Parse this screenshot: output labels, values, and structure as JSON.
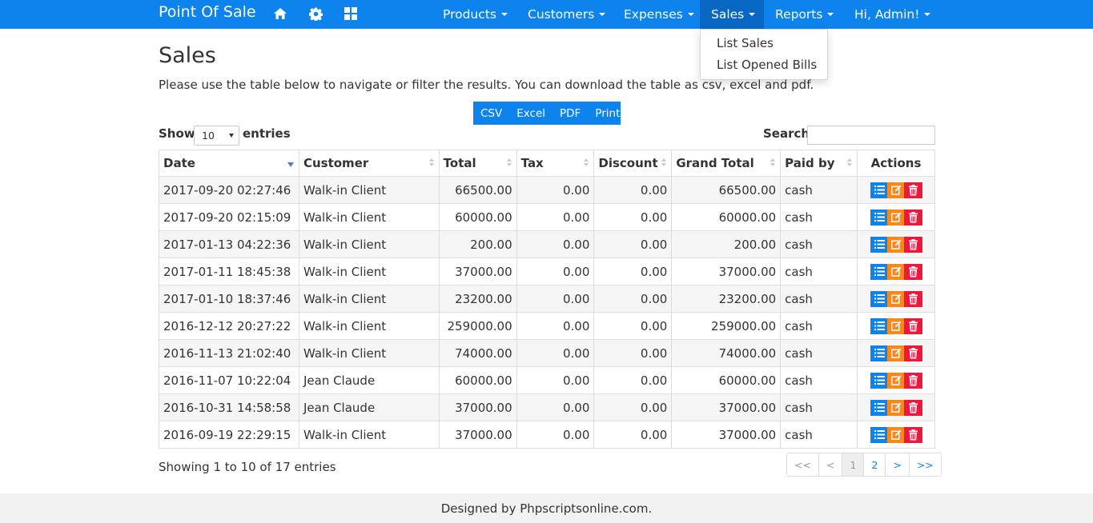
{
  "navbar": {
    "brand": "Point Of Sale",
    "icons": [
      "home-icon",
      "gear-icon",
      "grid-icon"
    ],
    "menus": [
      {
        "label": "Products"
      },
      {
        "label": "Customers"
      },
      {
        "label": "Expenses"
      },
      {
        "label": "Sales"
      },
      {
        "label": "Reports"
      },
      {
        "label": "Hi, Admin!"
      }
    ],
    "active_menu": "Sales"
  },
  "dropdown": {
    "items": [
      {
        "label": "List Sales"
      },
      {
        "label": "List Opened Bills"
      }
    ]
  },
  "page": {
    "title": "Sales",
    "intro": "Please use the table below to navigate or filter the results. You can download the table as csv, excel and pdf."
  },
  "exports": {
    "buttons": [
      {
        "label": "CSV"
      },
      {
        "label": "Excel"
      },
      {
        "label": "PDF"
      },
      {
        "label": "Print"
      }
    ]
  },
  "controls": {
    "show_label": "Show",
    "page_size": "10",
    "entries_label": "entries",
    "search_label": "Search",
    "search_value": ""
  },
  "table": {
    "columns": [
      "Date",
      "Customer",
      "Total",
      "Tax",
      "Discount",
      "Grand Total",
      "Paid by",
      "Actions"
    ],
    "rows": [
      {
        "date": "2017-09-20 02:27:46",
        "customer": "Walk-in Client",
        "total": "66500.00",
        "tax": "0.00",
        "discount": "0.00",
        "grand_total": "66500.00",
        "paid_by": "cash"
      },
      {
        "date": "2017-09-20 02:15:09",
        "customer": "Walk-in Client",
        "total": "60000.00",
        "tax": "0.00",
        "discount": "0.00",
        "grand_total": "60000.00",
        "paid_by": "cash"
      },
      {
        "date": "2017-01-13 04:22:36",
        "customer": "Walk-in Client",
        "total": "200.00",
        "tax": "0.00",
        "discount": "0.00",
        "grand_total": "200.00",
        "paid_by": "cash"
      },
      {
        "date": "2017-01-11 18:45:38",
        "customer": "Walk-in Client",
        "total": "37000.00",
        "tax": "0.00",
        "discount": "0.00",
        "grand_total": "37000.00",
        "paid_by": "cash"
      },
      {
        "date": "2017-01-10 18:37:46",
        "customer": "Walk-in Client",
        "total": "23200.00",
        "tax": "0.00",
        "discount": "0.00",
        "grand_total": "23200.00",
        "paid_by": "cash"
      },
      {
        "date": "2016-12-12 20:27:22",
        "customer": "Walk-in Client",
        "total": "259000.00",
        "tax": "0.00",
        "discount": "0.00",
        "grand_total": "259000.00",
        "paid_by": "cash"
      },
      {
        "date": "2016-11-13 21:02:40",
        "customer": "Walk-in Client",
        "total": "74000.00",
        "tax": "0.00",
        "discount": "0.00",
        "grand_total": "74000.00",
        "paid_by": "cash"
      },
      {
        "date": "2016-11-07 10:22:04",
        "customer": "Jean Claude",
        "total": "60000.00",
        "tax": "0.00",
        "discount": "0.00",
        "grand_total": "60000.00",
        "paid_by": "cash"
      },
      {
        "date": "2016-10-31 14:58:58",
        "customer": "Jean Claude",
        "total": "37000.00",
        "tax": "0.00",
        "discount": "0.00",
        "grand_total": "37000.00",
        "paid_by": "cash"
      },
      {
        "date": "2016-09-19 22:29:15",
        "customer": "Walk-in Client",
        "total": "37000.00",
        "tax": "0.00",
        "discount": "0.00",
        "grand_total": "37000.00",
        "paid_by": "cash"
      }
    ],
    "row_action_icons": [
      "list-icon",
      "edit-icon",
      "trash-icon"
    ]
  },
  "info": "Showing 1 to 10 of 17 entries",
  "pagination": [
    "<<",
    "<",
    "1",
    "2",
    ">",
    ">>"
  ],
  "footer": "Designed by Phpscriptsonline.com.",
  "colors": {
    "primary": "#0c83ed",
    "primary_dark": "#0867c3",
    "edit": "#f7891e",
    "delete": "#f0173c"
  }
}
